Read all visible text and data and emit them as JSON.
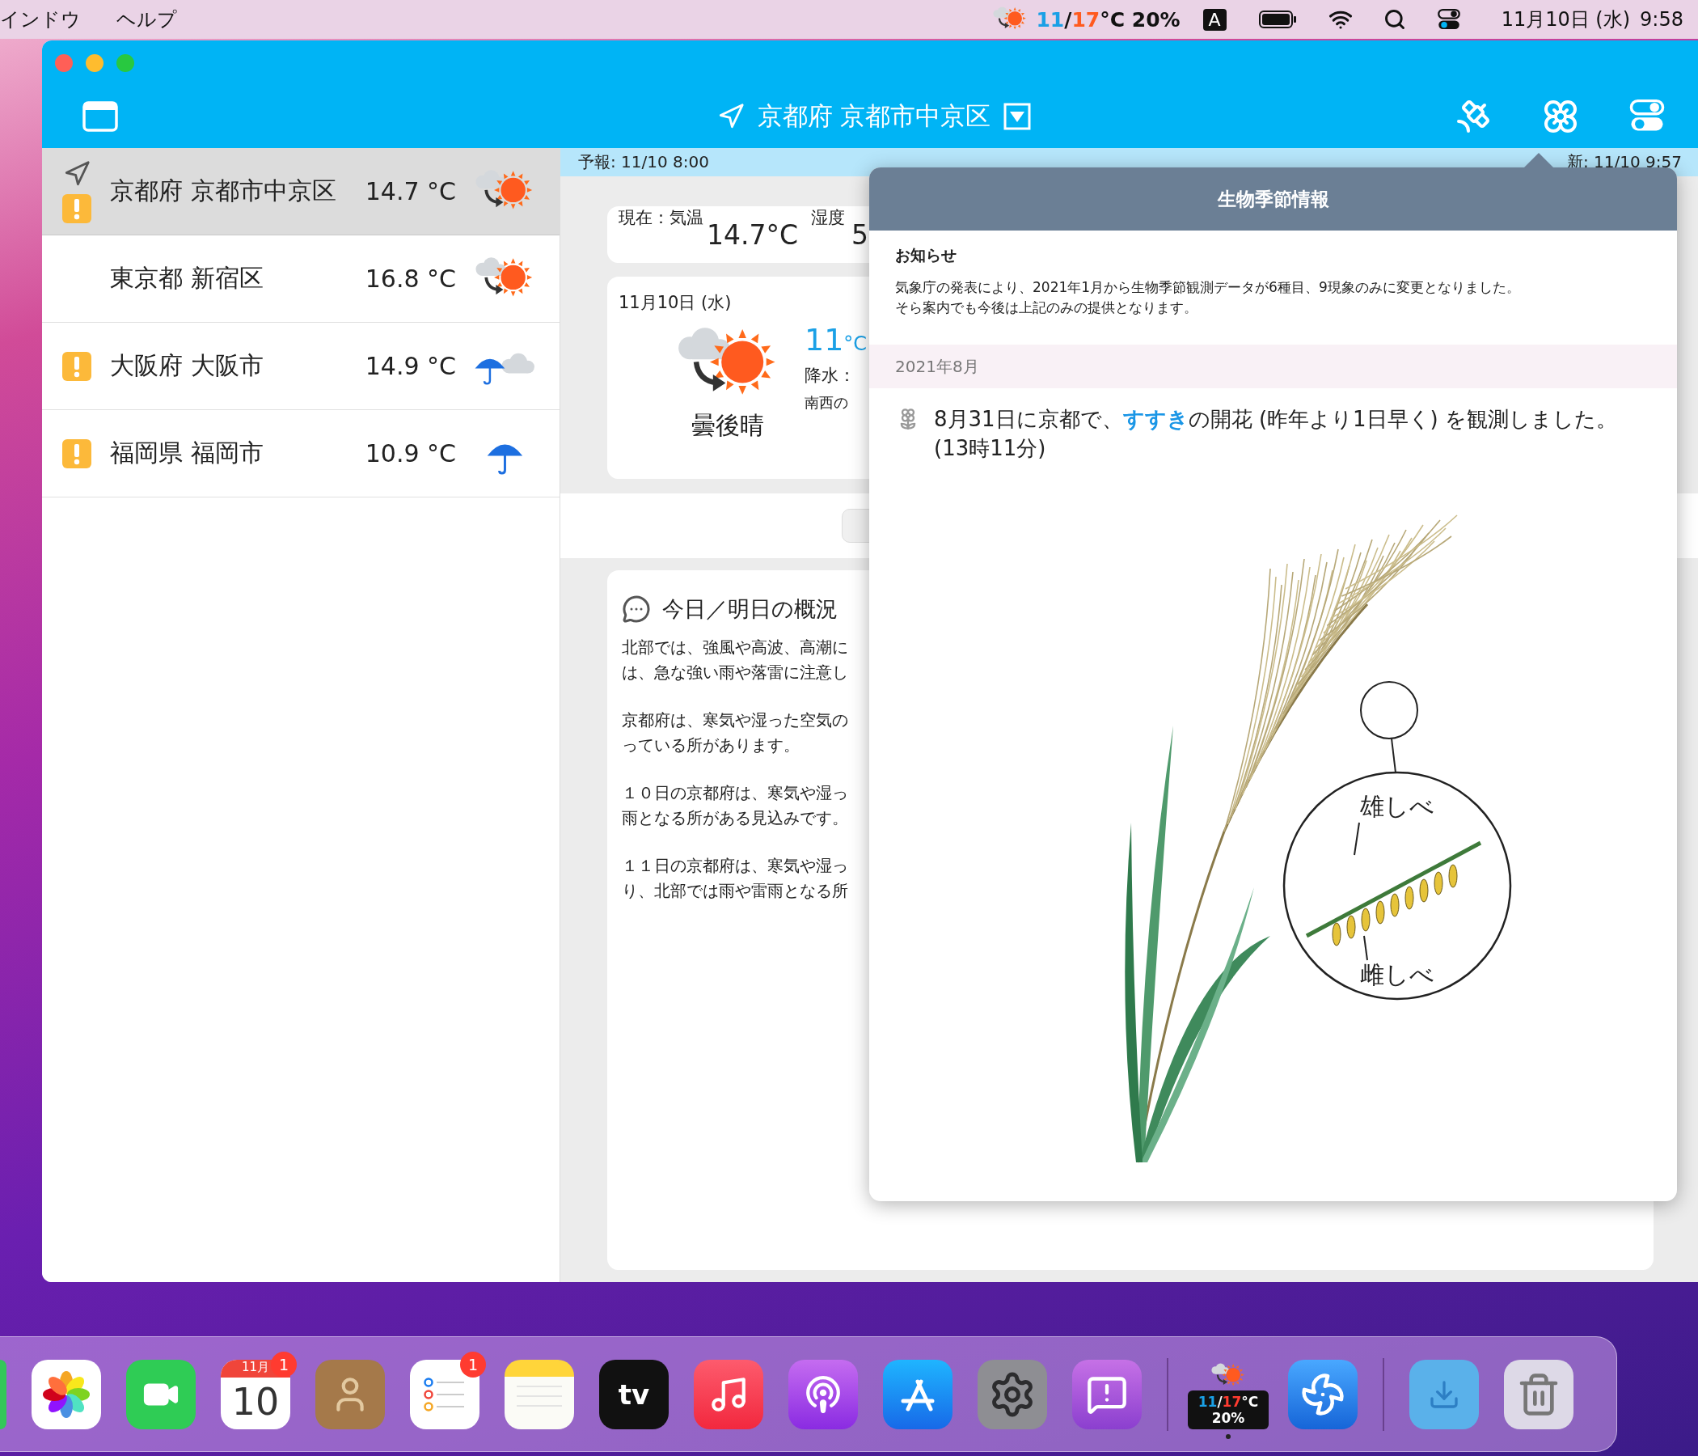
{
  "menubar": {
    "menus": [
      "インドウ",
      "ヘルプ"
    ],
    "weather": {
      "low": "11",
      "separator": "/",
      "high": "17",
      "unit": "°C",
      "precip": "20%"
    },
    "input_source": "A",
    "date": "11月10日 (水)",
    "time": "9:58"
  },
  "window": {
    "title": "京都府 京都市中京区"
  },
  "locations": [
    {
      "name": "京都府 京都市中京区",
      "temp": "14.7 °C",
      "kind": "cloudy_then_sunny",
      "current": true,
      "warning": true,
      "selected": true
    },
    {
      "name": "東京都 新宿区",
      "temp": "16.8 °C",
      "kind": "cloudy_then_sunny",
      "current": false,
      "warning": false,
      "selected": false
    },
    {
      "name": "大阪府 大阪市",
      "temp": "14.9 °C",
      "kind": "rain_then_cloudy",
      "current": false,
      "warning": true,
      "selected": false
    },
    {
      "name": "福岡県 福岡市",
      "temp": "10.9 °C",
      "kind": "rain",
      "current": false,
      "warning": true,
      "selected": false
    }
  ],
  "forecast_bar": {
    "issued": "予報: 11/10 8:00",
    "updated": "新: 11/10 9:57"
  },
  "current": {
    "label": "現在：気温",
    "temp": "14.7°C",
    "humidity_label": "湿度",
    "humidity_value": "5"
  },
  "day": {
    "date": "11月10日 (水)",
    "icon": {
      "kind": "cloudy_then_sunny"
    },
    "weather_label": "曇後晴",
    "temp": "11",
    "temp_unit": "°C",
    "precip_label": "降水：",
    "wind": "南西の"
  },
  "overview": {
    "title": "今日／明日の概況",
    "paragraphs": [
      "北部では、強風や高波、高潮には、急な強い雨や落雷に注意し",
      "京都府は、寒気や湿った空気のっている所があります。",
      "１０日の京都府は、寒気や湿っ雨となる所がある見込みです。",
      "１１日の京都府は、寒気や湿っり、北部では雨や雷雨となる所"
    ]
  },
  "popover": {
    "title": "生物季節情報",
    "notice_title": "お知らせ",
    "notice": [
      "気象庁の発表により、2021年1月から生物季節観測データが6種目、9現象のみに変更となりました。",
      "そら案内でも今後は上記のみの提供となります。"
    ],
    "section": "2021年8月",
    "entry": {
      "prefix": "8月31日に京都で、",
      "link": "すすき",
      "suffix": "の開花 (昨年より1日早く) を観測しました。",
      "time": "(13時11分)"
    },
    "stamen_label": "雄しべ",
    "pistil_label": "雌しべ"
  },
  "dock": [
    {
      "kind": "partial",
      "running": false
    },
    {
      "kind": "photos",
      "running": false
    },
    {
      "kind": "facetime",
      "running": false
    },
    {
      "kind": "calendar",
      "month": "11月",
      "day": "10",
      "badge": "1",
      "running": false
    },
    {
      "kind": "contacts",
      "running": false
    },
    {
      "kind": "reminders",
      "badge": "1",
      "running": false
    },
    {
      "kind": "notes",
      "running": false
    },
    {
      "kind": "tv",
      "label": "tv",
      "running": false
    },
    {
      "kind": "music",
      "running": false
    },
    {
      "kind": "podcasts",
      "running": false
    },
    {
      "kind": "appstore",
      "running": false
    },
    {
      "kind": "settings",
      "running": false
    },
    {
      "kind": "feedback",
      "running": false
    },
    {
      "kind": "separator"
    },
    {
      "kind": "weather",
      "low": "11",
      "separator": "/",
      "high": "17",
      "unit": "°C",
      "precip": "20%",
      "running": true
    },
    {
      "kind": "fan",
      "running": false
    },
    {
      "kind": "separator"
    },
    {
      "kind": "downloads",
      "running": false
    },
    {
      "kind": "trash",
      "running": false
    }
  ]
}
